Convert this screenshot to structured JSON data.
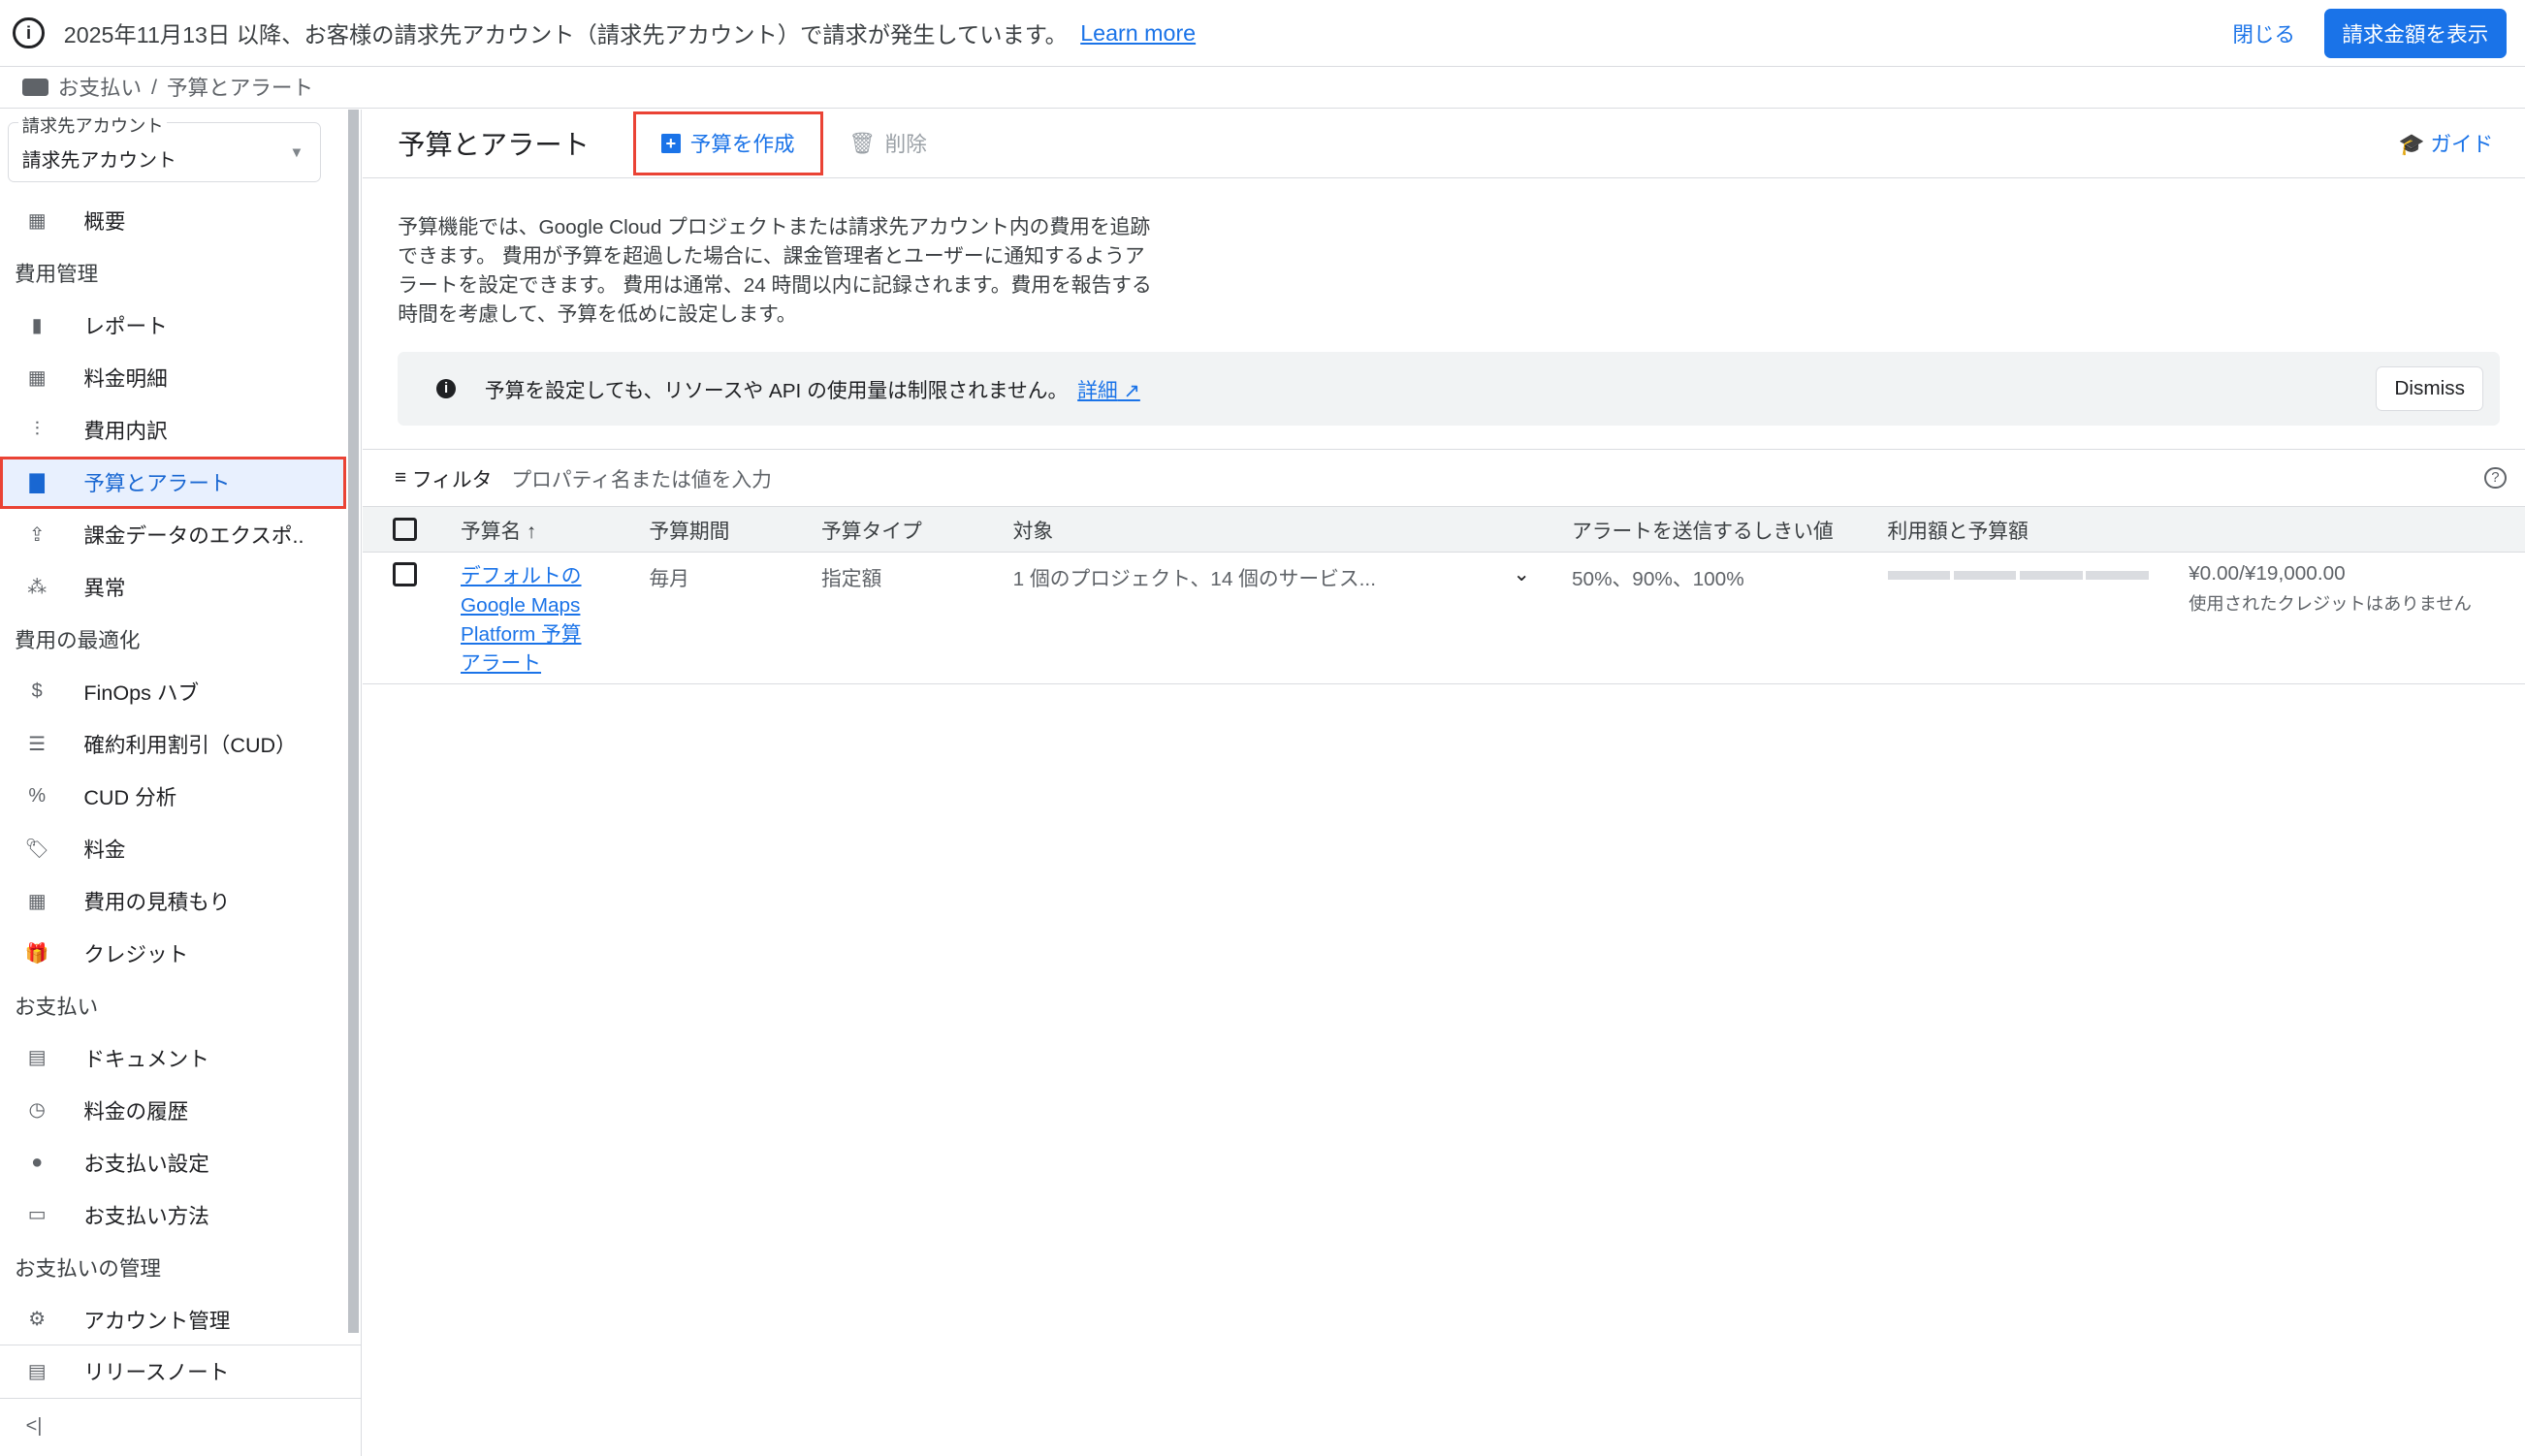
{
  "banner": {
    "message": "2025年11月13日 以降、お客様の請求先アカウント（請求先アカウント）で請求が発生しています。",
    "learn_more": "Learn more",
    "close": "閉じる",
    "show_billing": "請求金額を表示"
  },
  "breadcrumb": {
    "parent": "お支払い",
    "separator": "/",
    "current": "予算とアラート"
  },
  "sidebar": {
    "account_label": "請求先アカウント",
    "account_value": "請求先アカウント",
    "overview": "概要",
    "sections": [
      {
        "title": "費用管理",
        "items": [
          "レポート",
          "料金明細",
          "費用内訳",
          "予算とアラート",
          "課金データのエクスポ..",
          "異常"
        ]
      },
      {
        "title": "費用の最適化",
        "items": [
          "FinOps ハブ",
          "確約利用割引（CUD）",
          "CUD 分析",
          "料金",
          "費用の見積もり",
          "クレジット"
        ]
      },
      {
        "title": "お支払い",
        "items": [
          "ドキュメント",
          "料金の履歴",
          "お支払い設定",
          "お支払い方法"
        ]
      },
      {
        "title": "お支払いの管理",
        "items": [
          "アカウント管理"
        ]
      }
    ],
    "release_notes": "リリースノート",
    "collapse": "<|"
  },
  "main": {
    "title": "予算とアラート",
    "create": "予算を作成",
    "delete": "削除",
    "guide": "ガイド",
    "description": "予算機能では、Google Cloud プロジェクトまたは請求先アカウント内の費用を追跡できます。 費用が予算を超過した場合に、課金管理者とユーザーに通知するようアラートを設定できます。 費用は通常、24 時間以内に記録されます。費用を報告する時間を考慮して、予算を低めに設定します。",
    "note": "予算を設定しても、リソースや API の使用量は制限されません。",
    "note_link": "詳細",
    "dismiss": "Dismiss",
    "filter_label": "フィルタ",
    "filter_placeholder": "プロパティ名または値を入力",
    "columns": [
      "予算名",
      "予算期間",
      "予算タイプ",
      "対象",
      "アラートを送信するしきい値",
      "利用額と予算額"
    ],
    "rows": [
      {
        "name": "デフォルトの Google Maps Platform 予算アラート",
        "period": "毎月",
        "type": "指定額",
        "scope": "1 個のプロジェクト、14 個のサービス...",
        "thresholds": "50%、90%、100%",
        "spent_fraction": 0,
        "amount": "¥0.00/¥19,000.00",
        "credits": "使用されたクレジットはありません"
      }
    ]
  }
}
